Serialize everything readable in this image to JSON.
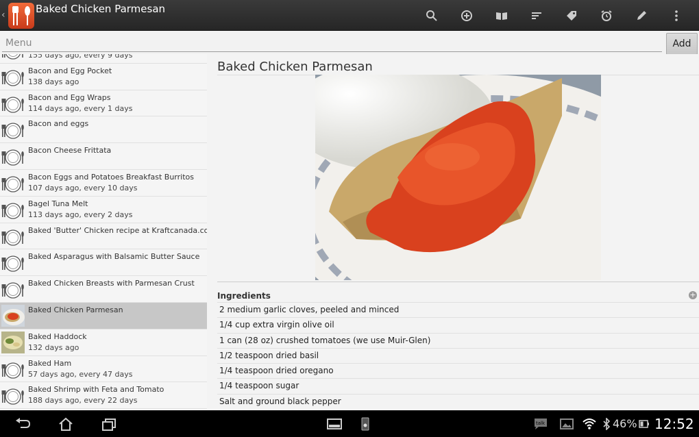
{
  "app": {
    "title": "Baked Chicken Parmesan",
    "toolbar_icons": [
      "search-icon",
      "add-circle-icon",
      "book-icon",
      "sort-icon",
      "tag-icon",
      "alarm-clock-icon",
      "pencil-icon",
      "overflow-menu-icon"
    ]
  },
  "search": {
    "placeholder": "Menu",
    "value": "",
    "add_label": "Add"
  },
  "recipes": [
    {
      "title": "",
      "subtitle": "155 days ago, every 9 days",
      "thumb": "plate-icon",
      "selected": false
    },
    {
      "title": "Bacon and Egg Pocket",
      "subtitle": "138 days ago",
      "thumb": "plate-icon",
      "selected": false
    },
    {
      "title": "Bacon and Egg Wraps",
      "subtitle": "114 days ago, every 1 days",
      "thumb": "plate-icon",
      "selected": false
    },
    {
      "title": "Bacon and eggs",
      "subtitle": "",
      "thumb": "plate-icon",
      "selected": false
    },
    {
      "title": "Bacon Cheese Frittata",
      "subtitle": "",
      "thumb": "plate-icon",
      "selected": false
    },
    {
      "title": "Bacon Eggs and Potatoes Breakfast Burritos",
      "subtitle": "107 days ago, every 10 days",
      "thumb": "plate-icon",
      "selected": false
    },
    {
      "title": "Bagel Tuna Melt",
      "subtitle": "113 days ago, every 2 days",
      "thumb": "plate-icon",
      "selected": false
    },
    {
      "title": "Baked 'Butter' Chicken recipe at Kraftcanada.com",
      "subtitle": "",
      "thumb": "plate-icon",
      "selected": false
    },
    {
      "title": "Baked Asparagus with Balsamic Butter Sauce",
      "subtitle": "",
      "thumb": "plate-icon",
      "selected": false
    },
    {
      "title": "Baked Chicken Breasts with Parmesan Crust",
      "subtitle": "",
      "thumb": "plate-icon",
      "selected": false
    },
    {
      "title": "Baked Chicken Parmesan",
      "subtitle": "",
      "thumb": "photo-chicken",
      "selected": true
    },
    {
      "title": "Baked Haddock",
      "subtitle": "132 days ago",
      "thumb": "photo-haddock",
      "selected": false
    },
    {
      "title": "Baked Ham",
      "subtitle": "57 days ago, every 47 days",
      "thumb": "plate-icon",
      "selected": false
    },
    {
      "title": "Baked Shrimp with Feta and Tomato",
      "subtitle": "188 days ago, every 22 days",
      "thumb": "plate-icon",
      "selected": false
    }
  ],
  "detail": {
    "title": "Baked Chicken Parmesan",
    "ingredients_label": "Ingredients",
    "ingredients": [
      "2 medium garlic cloves, peeled and minced",
      "1/4 cup extra virgin olive oil",
      "1 can (28 oz) crushed tomatoes (we use Muir-Glen)",
      "1/2 teaspoon dried basil",
      "1/4 teaspoon dried oregano",
      "1/4 teaspoon sugar",
      "Salt and ground black pepper"
    ]
  },
  "status": {
    "battery": "46%",
    "time": "12:52"
  }
}
